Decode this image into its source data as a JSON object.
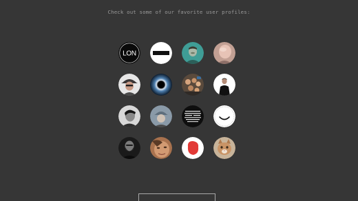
{
  "header": {
    "text": "Check out some of our favorite user profiles:"
  },
  "profiles": [
    {
      "icon": "lon-logo-avatar-icon",
      "logo_text": "LON"
    },
    {
      "icon": "minus-bar-avatar-icon"
    },
    {
      "icon": "teal-portrait-avatar-icon"
    },
    {
      "icon": "bald-man-portrait-avatar-icon"
    },
    {
      "icon": "hat-portrait-avatar-icon"
    },
    {
      "icon": "eclipse-avatar-icon"
    },
    {
      "icon": "group-photo-avatar-icon"
    },
    {
      "icon": "man-in-black-avatar-icon"
    },
    {
      "icon": "bw-portrait-avatar-icon"
    },
    {
      "icon": "cap-portrait-avatar-icon"
    },
    {
      "icon": "text-collage-avatar-icon"
    },
    {
      "icon": "smile-avatar-icon"
    },
    {
      "icon": "bearded-man-avatar-icon"
    },
    {
      "icon": "close-up-portrait-avatar-icon"
    },
    {
      "icon": "red-blob-avatar-icon"
    },
    {
      "icon": "cat-avatar-icon"
    }
  ],
  "more_button": {
    "label": ""
  }
}
